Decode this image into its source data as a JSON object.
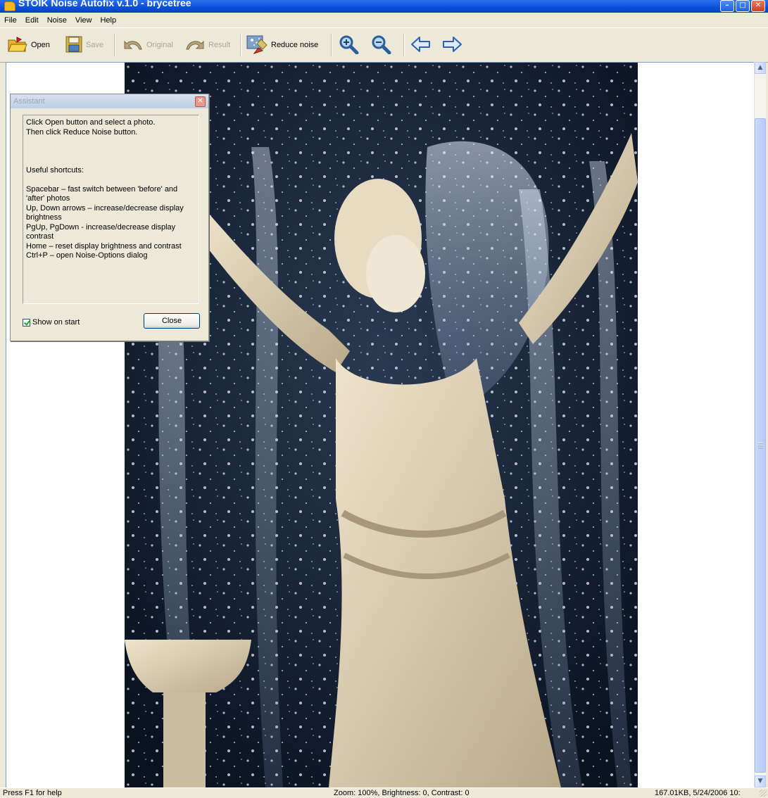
{
  "window": {
    "title": "STOIK Noise Autofix v.1.0 - brycetree",
    "controls": {
      "minimize": "–",
      "maximize": "□",
      "close": "✕"
    }
  },
  "menu": [
    "File",
    "Edit",
    "Noise",
    "View",
    "Help"
  ],
  "toolbar": {
    "open": "Open",
    "save": "Save",
    "original": "Original",
    "result": "Result",
    "reduce_noise": "Reduce noise"
  },
  "icons": {
    "open": "folder-open-icon",
    "save": "floppy-disk-icon",
    "original": "curved-arrow-left-icon",
    "result": "curved-arrow-right-icon",
    "reduce_noise": "reduce-noise-icon",
    "zoom_in": "zoom-in-icon",
    "zoom_out": "zoom-out-icon",
    "prev": "arrow-left-icon",
    "next": "arrow-right-icon"
  },
  "assistant": {
    "title": "Assistant",
    "text": "Click Open button and select a photo.\nThen click Reduce Noise button.\n\n\n\nUseful shortcuts:\n\nSpacebar – fast switch between 'before' and 'after' photos\nUp, Down arrows – increase/decrease display brightness\nPgUp, PgDown - increase/decrease display contrast\nHome – reset display brightness and contrast\nCtrl+P – open Noise-Options dialog",
    "show_on_start_label": "Show on start",
    "show_on_start_checked": true,
    "close_label": "Close"
  },
  "status": {
    "help": "Press F1 for help",
    "info": "Zoom: 100%, Brightness: 0, Contrast: 0",
    "file": "167.01KB, 5/24/2006 10:"
  },
  "colors": {
    "title_bar": "#0a4fd8",
    "chrome": "#ece9d8",
    "canvas": "#ffffff",
    "photo_background": "#101c2c"
  }
}
